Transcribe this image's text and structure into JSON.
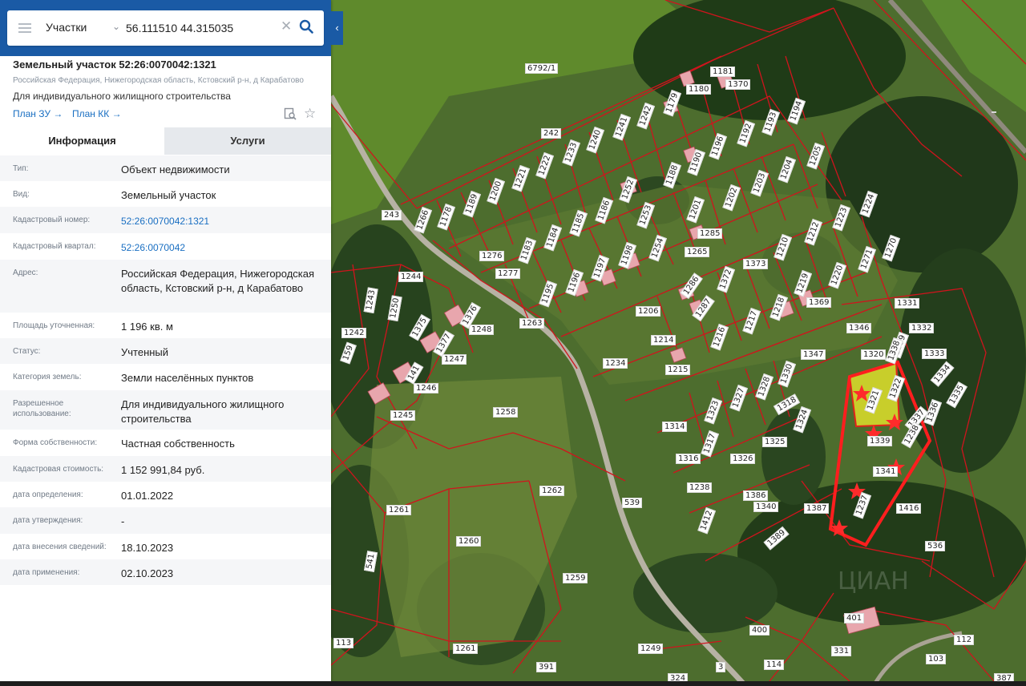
{
  "search": {
    "layer": "Участки",
    "query": "56.111510 44.315035"
  },
  "object": {
    "title": "Земельный участок 52:26:0070042:1321",
    "address": "Российская Федерация, Нижегородская область, Кстовский р-н, д Карабатово",
    "purpose": "Для индивидуального жилищного строительства",
    "plan_zu": "План ЗУ →",
    "plan_kk": "План КК →"
  },
  "tabs": {
    "info": "Информация",
    "services": "Услуги"
  },
  "info": [
    {
      "label": "Тип:",
      "value": "Объект недвижимости"
    },
    {
      "label": "Вид:",
      "value": "Земельный участок"
    },
    {
      "label": "Кадастровый номер:",
      "value": "52:26:0070042:1321"
    },
    {
      "label": "Кадастровый квартал:",
      "value": "52:26:0070042"
    },
    {
      "label": "Адрес:",
      "value": "Российская Федерация, Нижегородская область, Кстовский р-н, д Карабатово"
    },
    {
      "label": "Площадь уточненная:",
      "value": "1 196 кв. м"
    },
    {
      "label": "Статус:",
      "value": "Учтенный"
    },
    {
      "label": "Категория земель:",
      "value": "Земли населённых пунктов"
    },
    {
      "label": "Разрешенное использование:",
      "value": "Для индивидуального жилищного строительства"
    },
    {
      "label": "Форма собственности:",
      "value": "Частная собственность"
    },
    {
      "label": "Кадастровая стоимость:",
      "value": "1 152 991,84 руб."
    },
    {
      "label": "дата определения:",
      "value": "01.01.2022"
    },
    {
      "label": "дата утверждения:",
      "value": "-"
    },
    {
      "label": "дата внесения сведений:",
      "value": "18.10.2023"
    },
    {
      "label": "дата применения:",
      "value": "02.10.2023"
    }
  ],
  "map_labels": [
    "6792/1",
    "1181",
    "1370",
    "1180",
    "1179",
    "1242",
    "1241",
    "1240",
    "1233",
    "1222",
    "1221",
    "242",
    "1200",
    "1189",
    "1178",
    "1266",
    "243",
    "1196",
    "1192",
    "1193",
    "1194",
    "1205",
    "1204",
    "1203",
    "1202",
    "1201",
    "1190",
    "1188",
    "1252",
    "1253",
    "1186",
    "1185",
    "1184",
    "1183",
    "1276",
    "1277",
    "1195",
    "1196",
    "1197",
    "1198",
    "1254",
    "1265",
    "1285",
    "1373",
    "1210",
    "1212",
    "1223",
    "1224",
    "1271",
    "1270",
    "1220",
    "1219",
    "1369",
    "1218",
    "1217",
    "1216",
    "1287",
    "1286",
    "1372",
    "1206",
    "1214",
    "1215",
    "1234",
    "1331",
    "1346",
    "1332",
    "1333",
    "1320",
    "1347",
    "1339",
    "1330",
    "1334",
    "1335",
    "1336",
    "1337",
    "1238",
    "1322",
    "1321",
    "1338",
    "1339",
    "1328",
    "1327",
    "1323",
    "1318",
    "1324",
    "1314",
    "1317",
    "1325",
    "1316",
    "1326",
    "1238",
    "1386",
    "1340",
    "1341",
    "1237",
    "1416",
    "1387",
    "1412",
    "1389",
    "536",
    "539",
    "1263",
    "1262",
    "1261",
    "1260",
    "1258",
    "1259",
    "1249",
    "1248",
    "1247",
    "1246",
    "1245",
    "1244",
    "1243",
    "1242",
    "1250",
    "1375",
    "1376",
    "1377",
    "141",
    "1261",
    "541",
    "159",
    "113",
    "401",
    "400",
    "114",
    "331",
    "112",
    "103",
    "387",
    "391",
    "324",
    "3"
  ]
}
